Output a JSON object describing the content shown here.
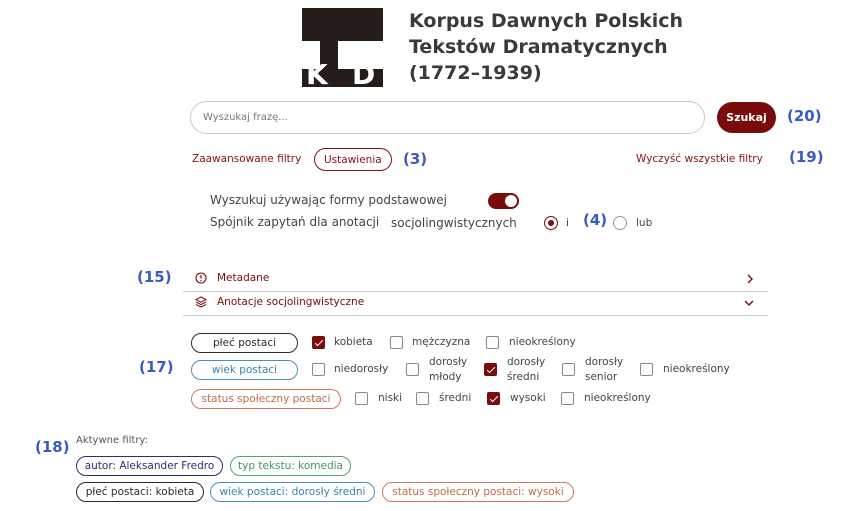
{
  "header": {
    "logo_letters": [
      "K",
      "D"
    ],
    "title_lines": [
      "Korpus Dawnych Polskich",
      "Tekstów Dramatycznych",
      "(1772–1939)"
    ]
  },
  "search": {
    "placeholder": "Wyszukaj frazę...",
    "button_label": "Szukaj"
  },
  "annotations": {
    "n20": "(20)",
    "n3": "(3)",
    "n19": "(19)",
    "n4": "(4)",
    "n15": "(15)",
    "n17": "(17)",
    "n18": "(18)"
  },
  "filters_bar": {
    "advanced_label": "Zaawansowane filtry",
    "settings_label": "Ustawienia",
    "clear_all_label": "Wyczyść wszystkie filtry"
  },
  "options": {
    "base_form_label": "Wyszukuj używając formy podstawowej",
    "base_form_enabled": true,
    "conjunction_label": "Spójnik zapytań dla anotacji",
    "conjunction_label_2": "socjolingwistycznych",
    "conjunction_options": [
      {
        "label": "i",
        "selected": true
      },
      {
        "label": "lub",
        "selected": false
      }
    ]
  },
  "accordions": [
    {
      "label": "Metadane",
      "icon": "info-icon",
      "expanded": false
    },
    {
      "label": "Anotacje socjolingwistyczne",
      "icon": "layers-icon",
      "expanded": true
    }
  ],
  "socio_filters": [
    {
      "group": "płeć postaci",
      "color": "#2b2b2b",
      "options": [
        {
          "label": "kobieta",
          "checked": true
        },
        {
          "label": "mężczyzna",
          "checked": false
        },
        {
          "label": "nieokreślony",
          "checked": false
        }
      ]
    },
    {
      "group": "wiek postaci",
      "color": "#3b83ad",
      "options": [
        {
          "label": "niedorosły",
          "checked": false
        },
        {
          "label": "dorosły młody",
          "line1": "dorosły",
          "line2": "młody",
          "checked": false
        },
        {
          "label": "dorosły średni",
          "line1": "dorosły",
          "line2": "średni",
          "checked": true
        },
        {
          "label": "dorosły senior",
          "line1": "dorosły",
          "line2": "senior",
          "checked": false
        },
        {
          "label": "nieokreślony",
          "checked": false
        }
      ]
    },
    {
      "group": "status społeczny postaci",
      "color": "#c56a4c",
      "options": [
        {
          "label": "niski",
          "checked": false
        },
        {
          "label": "średni",
          "checked": false
        },
        {
          "label": "wysoki",
          "checked": true
        },
        {
          "label": "nieokreślony",
          "checked": false
        }
      ]
    }
  ],
  "active_filters": {
    "label": "Aktywne filtry:",
    "chips": [
      {
        "text": "autor: Aleksander Fredro",
        "color": "#2a2c7a"
      },
      {
        "text": "typ tekstu: komedia",
        "color": "#3d9a59"
      },
      {
        "text": "płeć postaci: kobieta",
        "color": "#2b2b2b"
      },
      {
        "text": "wiek postaci: dorosły średni",
        "color": "#3b83ad"
      },
      {
        "text": "status społeczny postaci: wysoki",
        "color": "#c56a4c"
      }
    ]
  }
}
